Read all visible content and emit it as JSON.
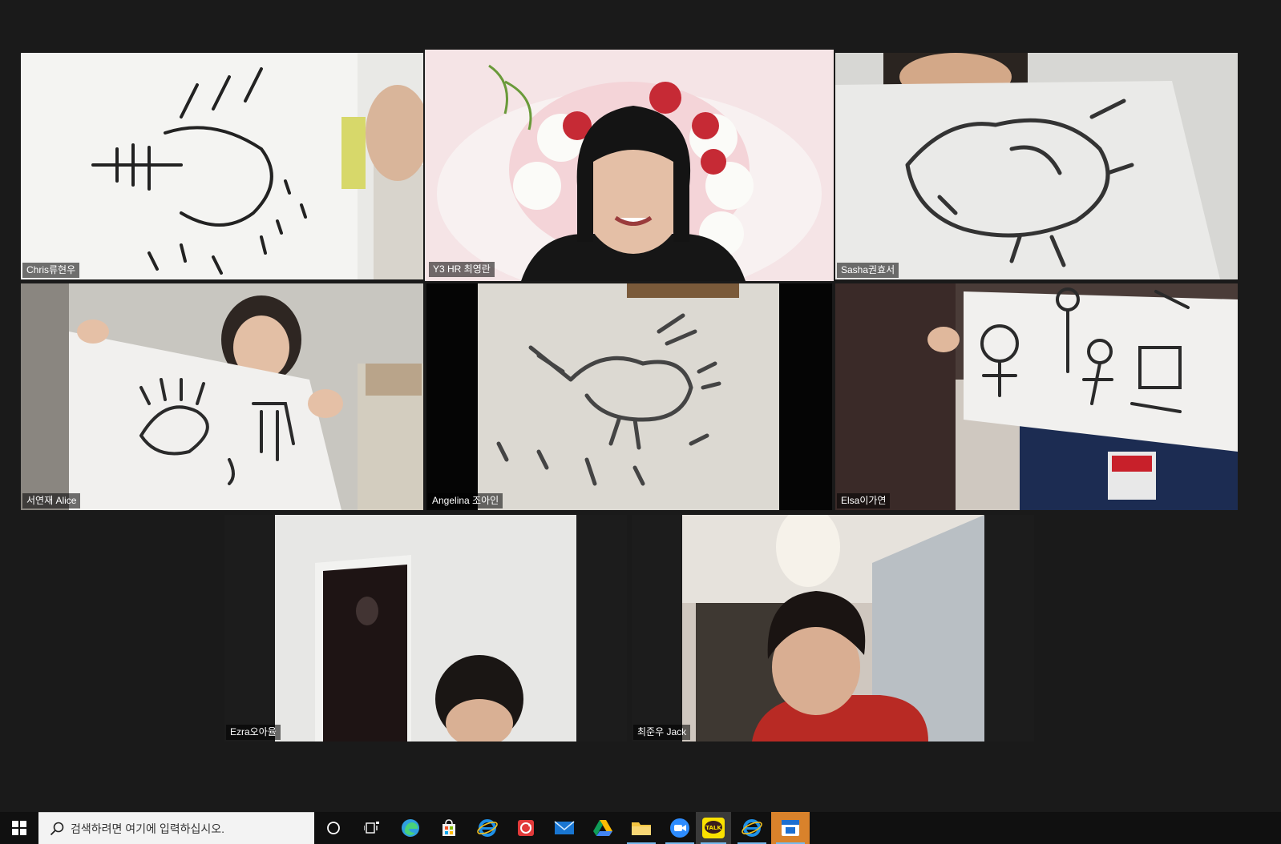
{
  "participants": [
    {
      "name": "Chris류현우"
    },
    {
      "name": "Y3 HR 최영란",
      "active": true
    },
    {
      "name": "Sasha권효서"
    },
    {
      "name": "서연재  Alice"
    },
    {
      "name": "Angelina 조아인"
    },
    {
      "name": "Elsa이가연"
    },
    {
      "name": "Ezra오아율"
    },
    {
      "name": "최준우  Jack"
    }
  ],
  "taskbar": {
    "search_placeholder": "검색하려면 여기에 입력하십시오.",
    "kakao_label": "TALK"
  },
  "colors": {
    "active_speaker_border": "#c9e63a",
    "taskbar_bg": "#101010",
    "accent": "#76b9ed"
  }
}
